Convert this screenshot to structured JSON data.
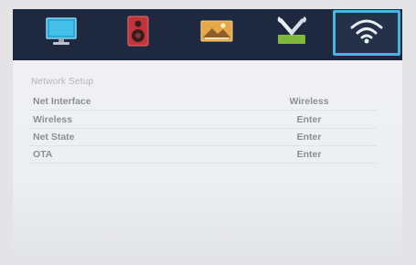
{
  "tabs": [
    {
      "icon": "monitor-icon",
      "selected": false
    },
    {
      "icon": "speaker-icon",
      "selected": false
    },
    {
      "icon": "picture-icon",
      "selected": false
    },
    {
      "icon": "tools-icon",
      "selected": false
    },
    {
      "icon": "wifi-icon",
      "selected": true
    }
  ],
  "section_title": "Network Setup",
  "rows": [
    {
      "label": "Net Interface",
      "value": "Wireless"
    },
    {
      "label": "Wireless",
      "value": "Enter"
    },
    {
      "label": "Net State",
      "value": "Enter"
    },
    {
      "label": "OTA",
      "value": "Enter"
    }
  ],
  "colors": {
    "tab_bar_bg": "#1e2940",
    "selected_border": "#49b3e6"
  }
}
